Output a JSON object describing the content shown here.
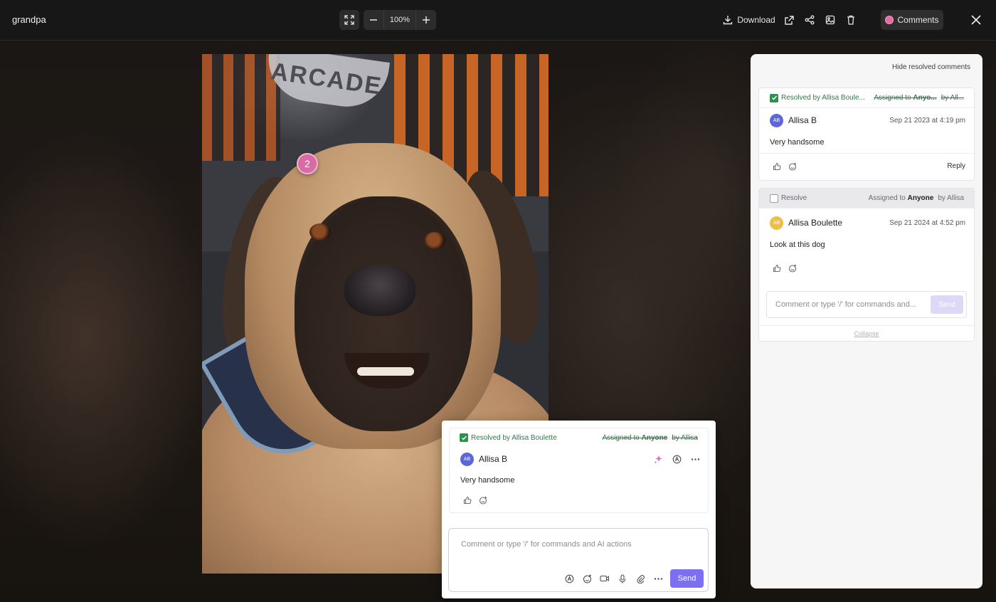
{
  "window": {
    "title": "grandpa"
  },
  "toolbar": {
    "zoom_level": "100%",
    "download_label": "Download",
    "comments_label": "Comments",
    "icons": [
      "fit-screen-icon",
      "zoom-out-icon",
      "zoom-in-icon",
      "download-icon",
      "external-link-icon",
      "share-icon",
      "image-icon",
      "trash-icon",
      "close-icon"
    ]
  },
  "image": {
    "pin_number": "2",
    "shirt_text": "ARCADE"
  },
  "sidebar": {
    "hide_resolved_label": "Hide resolved comments",
    "threads": [
      {
        "status": "Resolved by Allisa Boule...",
        "assigned_prefix": "Assigned to",
        "assigned_to": "Anyo...",
        "assigned_by": "by All...",
        "author_initials": "AB",
        "author": "Allisa B",
        "timestamp": "Sep 21 2023 at 4:19 pm",
        "body": "Very handsome",
        "reply_label": "Reply"
      },
      {
        "status": "Resolve",
        "assigned_prefix": "Assigned to",
        "assigned_to": "Anyone",
        "assigned_by": "by Allisa",
        "author_initials": "AB",
        "author": "Allisa Boulette",
        "timestamp": "Sep 21 2024 at 4:52 pm",
        "body": "Look at this dog",
        "input_placeholder": "Comment or type '/' for commands and...",
        "send_label": "Send",
        "collapse_label": "Collapse"
      }
    ]
  },
  "popup": {
    "status": "Resolved by Allisa Boulette",
    "assigned_prefix": "Assigned to",
    "assigned_to": "Anyone",
    "assigned_by": "by Allisa",
    "author_initials": "AB",
    "author": "Allisa B",
    "body": "Very handsome",
    "input_placeholder": "Comment or type '/' for commands and AI actions",
    "send_label": "Send"
  },
  "colors": {
    "accent": "#7c6ff0",
    "resolved_green": "#2f8f4e",
    "pin_pink": "#d86aa4"
  }
}
